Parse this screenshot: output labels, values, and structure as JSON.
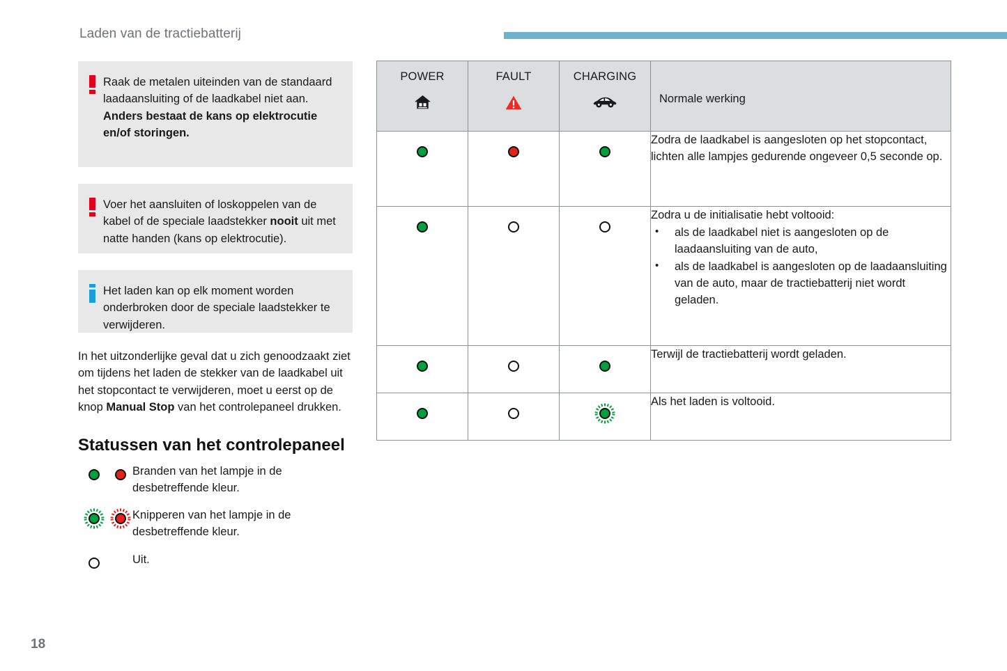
{
  "header": {
    "title": "Laden van de tractiebatterij",
    "rule_color": "#6cb3d0"
  },
  "notices": [
    {
      "icon": "warning-exclamation-icon",
      "text_plain": "Raak de metalen uiteinden van de standaard laadaansluiting of de laadkabel niet aan. Anders bestaat de kans op elektrocutie en/of storingen.",
      "text_normal": "Raak de metalen uiteinden van de standaard laadaansluiting of de laadkabel niet aan. ",
      "text_bold": "Anders bestaat de kans op elektrocutie en/of storingen."
    },
    {
      "icon": "warning-exclamation-icon",
      "text_plain": "Voer het aansluiten of loskoppelen van de kabel of de speciale laadstekker nooit uit met natte handen (kans op elektrocutie).",
      "part1": "Voer het aansluiten of loskoppelen van de kabel of de speciale laadstekker ",
      "part_bold": "nooit",
      "part2": " uit met natte handen (kans op elektrocutie)."
    },
    {
      "icon": "info-i-icon",
      "text_plain": "Het laden kan op elk moment worden onderbroken door de speciale laadstekker te verwijderen."
    }
  ],
  "body_paragraph": {
    "part1": "In het uitzonderlijke geval dat u zich genoodzaakt ziet om tijdens het laden de stekker van de laadkabel uit het stopcontact te verwijderen, moet u eerst op de knop ",
    "part_bold": "Manual Stop",
    "part2": " van het controlepaneel drukken."
  },
  "section": {
    "heading": "Statussen van het controlepaneel"
  },
  "legend": [
    {
      "icons": [
        "green-on",
        "red-on"
      ],
      "text": "Branden van het lampje in de desbetreffende kleur."
    },
    {
      "icons": [
        "green-blink",
        "red-blink"
      ],
      "text": "Knipperen van het lampje in de desbetreffende kleur."
    },
    {
      "icons": [
        "off"
      ],
      "text": "Uit."
    }
  ],
  "table": {
    "columns": [
      {
        "label": "POWER",
        "icon": "house-icon"
      },
      {
        "label": "FAULT",
        "icon": "warning-triangle-icon"
      },
      {
        "label": "CHARGING",
        "icon": "car-icon"
      }
    ],
    "header_description": "Normale werking",
    "rows": [
      {
        "power": "green-on",
        "fault": "red-on",
        "charging": "green-on",
        "description": "Zodra de laadkabel is aangesloten op het stopcontact, lichten alle lampjes gedurende ongeveer 0,5 seconde op.",
        "bullets": []
      },
      {
        "power": "green-on",
        "fault": "off",
        "charging": "off",
        "description": "Zodra u de initialisatie hebt voltooid:",
        "bullets": [
          "als de laadkabel niet is aangesloten op de laadaansluiting van de auto,",
          "als de laadkabel is aangesloten op de laadaansluiting van de auto, maar de tractiebatterij niet wordt geladen."
        ]
      },
      {
        "power": "green-on",
        "fault": "off",
        "charging": "green-on",
        "description": "Terwijl de tractiebatterij wordt geladen.",
        "bullets": []
      },
      {
        "power": "green-on",
        "fault": "off",
        "charging": "green-blink",
        "description": "Als het laden is voltooid.",
        "bullets": []
      }
    ]
  },
  "footer": {
    "page_number": "18"
  },
  "colors": {
    "accent_blue": "#6cb3d0",
    "warning_red": "#e2001a",
    "info_blue": "#1b9dd9",
    "led_green": "#00a03c",
    "led_red": "#e32219",
    "notice_bg": "#e8e8e9",
    "table_header_bg": "#dcdddf",
    "table_border": "#8d9094",
    "muted_text": "#6f7276"
  }
}
